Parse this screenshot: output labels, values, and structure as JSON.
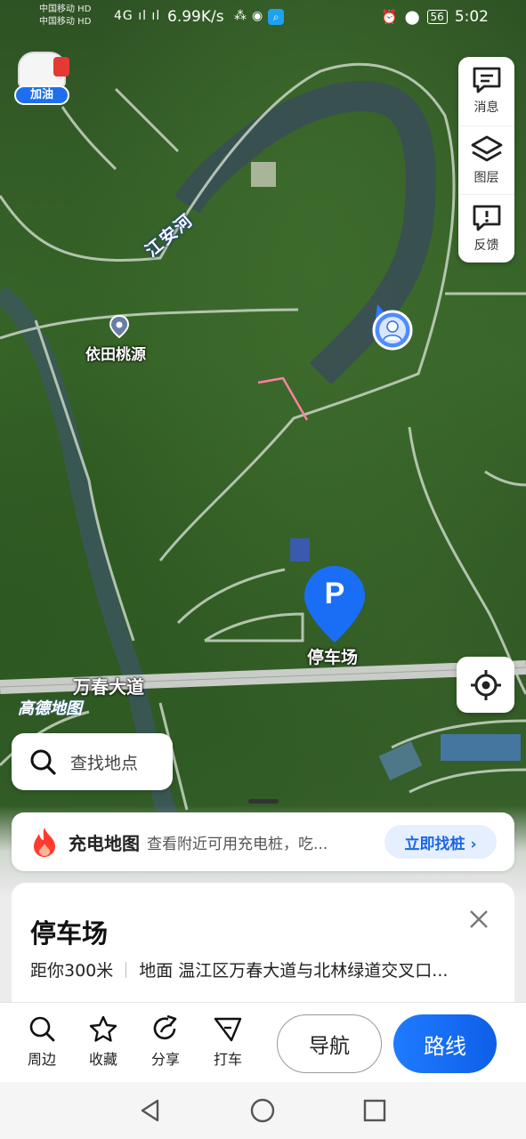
{
  "status_bar": {
    "carrier_1": "中国移动 HD",
    "carrier_2": "中国移动 HD",
    "signal": "4G ıl ıl",
    "speed": "6.99K/s",
    "battery": "56",
    "time": "5:02"
  },
  "map": {
    "gas_badge_label": "加油",
    "river_label": "江安河",
    "poi_name": "依田桃源",
    "road_name": "万春大道",
    "map_logo": "高德地图",
    "parking_marker_letter": "P",
    "parking_marker_name": "停车场"
  },
  "tools": [
    {
      "icon": "message-icon",
      "label": "消息"
    },
    {
      "icon": "layers-icon",
      "label": "图层"
    },
    {
      "icon": "feedback-icon",
      "label": "反馈"
    }
  ],
  "search": {
    "placeholder": "查找地点"
  },
  "charging_banner": {
    "icon": "flame-icon",
    "title": "充电地图",
    "description": "查看附近可用充电桩，吃...",
    "button_label": "立即找桩 ›"
  },
  "place_card": {
    "title": "停车场",
    "distance": "距你300米",
    "address": "地面 温江区万春大道与北林绿道交叉口..."
  },
  "actions": [
    {
      "icon": "search-icon",
      "label": "周边"
    },
    {
      "icon": "star-icon",
      "label": "收藏"
    },
    {
      "icon": "share-icon",
      "label": "分享"
    },
    {
      "icon": "taxi-icon",
      "label": "打车"
    }
  ],
  "navigate_label": "导航",
  "route_label": "路线",
  "colors": {
    "primary_blue": "#1f7bff",
    "charge_button_bg": "#e6efff",
    "gas_badge_blue": "#1e6ff0"
  }
}
